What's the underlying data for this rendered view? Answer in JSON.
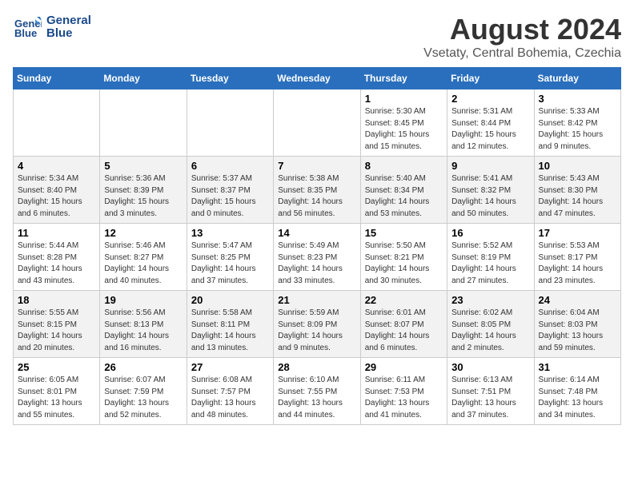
{
  "header": {
    "logo_line1": "General",
    "logo_line2": "Blue",
    "title": "August 2024",
    "subtitle": "Vsetaty, Central Bohemia, Czechia"
  },
  "weekdays": [
    "Sunday",
    "Monday",
    "Tuesday",
    "Wednesday",
    "Thursday",
    "Friday",
    "Saturday"
  ],
  "weeks": [
    [
      {
        "day": "",
        "info": ""
      },
      {
        "day": "",
        "info": ""
      },
      {
        "day": "",
        "info": ""
      },
      {
        "day": "",
        "info": ""
      },
      {
        "day": "1",
        "info": "Sunrise: 5:30 AM\nSunset: 8:45 PM\nDaylight: 15 hours\nand 15 minutes."
      },
      {
        "day": "2",
        "info": "Sunrise: 5:31 AM\nSunset: 8:44 PM\nDaylight: 15 hours\nand 12 minutes."
      },
      {
        "day": "3",
        "info": "Sunrise: 5:33 AM\nSunset: 8:42 PM\nDaylight: 15 hours\nand 9 minutes."
      }
    ],
    [
      {
        "day": "4",
        "info": "Sunrise: 5:34 AM\nSunset: 8:40 PM\nDaylight: 15 hours\nand 6 minutes."
      },
      {
        "day": "5",
        "info": "Sunrise: 5:36 AM\nSunset: 8:39 PM\nDaylight: 15 hours\nand 3 minutes."
      },
      {
        "day": "6",
        "info": "Sunrise: 5:37 AM\nSunset: 8:37 PM\nDaylight: 15 hours\nand 0 minutes."
      },
      {
        "day": "7",
        "info": "Sunrise: 5:38 AM\nSunset: 8:35 PM\nDaylight: 14 hours\nand 56 minutes."
      },
      {
        "day": "8",
        "info": "Sunrise: 5:40 AM\nSunset: 8:34 PM\nDaylight: 14 hours\nand 53 minutes."
      },
      {
        "day": "9",
        "info": "Sunrise: 5:41 AM\nSunset: 8:32 PM\nDaylight: 14 hours\nand 50 minutes."
      },
      {
        "day": "10",
        "info": "Sunrise: 5:43 AM\nSunset: 8:30 PM\nDaylight: 14 hours\nand 47 minutes."
      }
    ],
    [
      {
        "day": "11",
        "info": "Sunrise: 5:44 AM\nSunset: 8:28 PM\nDaylight: 14 hours\nand 43 minutes."
      },
      {
        "day": "12",
        "info": "Sunrise: 5:46 AM\nSunset: 8:27 PM\nDaylight: 14 hours\nand 40 minutes."
      },
      {
        "day": "13",
        "info": "Sunrise: 5:47 AM\nSunset: 8:25 PM\nDaylight: 14 hours\nand 37 minutes."
      },
      {
        "day": "14",
        "info": "Sunrise: 5:49 AM\nSunset: 8:23 PM\nDaylight: 14 hours\nand 33 minutes."
      },
      {
        "day": "15",
        "info": "Sunrise: 5:50 AM\nSunset: 8:21 PM\nDaylight: 14 hours\nand 30 minutes."
      },
      {
        "day": "16",
        "info": "Sunrise: 5:52 AM\nSunset: 8:19 PM\nDaylight: 14 hours\nand 27 minutes."
      },
      {
        "day": "17",
        "info": "Sunrise: 5:53 AM\nSunset: 8:17 PM\nDaylight: 14 hours\nand 23 minutes."
      }
    ],
    [
      {
        "day": "18",
        "info": "Sunrise: 5:55 AM\nSunset: 8:15 PM\nDaylight: 14 hours\nand 20 minutes."
      },
      {
        "day": "19",
        "info": "Sunrise: 5:56 AM\nSunset: 8:13 PM\nDaylight: 14 hours\nand 16 minutes."
      },
      {
        "day": "20",
        "info": "Sunrise: 5:58 AM\nSunset: 8:11 PM\nDaylight: 14 hours\nand 13 minutes."
      },
      {
        "day": "21",
        "info": "Sunrise: 5:59 AM\nSunset: 8:09 PM\nDaylight: 14 hours\nand 9 minutes."
      },
      {
        "day": "22",
        "info": "Sunrise: 6:01 AM\nSunset: 8:07 PM\nDaylight: 14 hours\nand 6 minutes."
      },
      {
        "day": "23",
        "info": "Sunrise: 6:02 AM\nSunset: 8:05 PM\nDaylight: 14 hours\nand 2 minutes."
      },
      {
        "day": "24",
        "info": "Sunrise: 6:04 AM\nSunset: 8:03 PM\nDaylight: 13 hours\nand 59 minutes."
      }
    ],
    [
      {
        "day": "25",
        "info": "Sunrise: 6:05 AM\nSunset: 8:01 PM\nDaylight: 13 hours\nand 55 minutes."
      },
      {
        "day": "26",
        "info": "Sunrise: 6:07 AM\nSunset: 7:59 PM\nDaylight: 13 hours\nand 52 minutes."
      },
      {
        "day": "27",
        "info": "Sunrise: 6:08 AM\nSunset: 7:57 PM\nDaylight: 13 hours\nand 48 minutes."
      },
      {
        "day": "28",
        "info": "Sunrise: 6:10 AM\nSunset: 7:55 PM\nDaylight: 13 hours\nand 44 minutes."
      },
      {
        "day": "29",
        "info": "Sunrise: 6:11 AM\nSunset: 7:53 PM\nDaylight: 13 hours\nand 41 minutes."
      },
      {
        "day": "30",
        "info": "Sunrise: 6:13 AM\nSunset: 7:51 PM\nDaylight: 13 hours\nand 37 minutes."
      },
      {
        "day": "31",
        "info": "Sunrise: 6:14 AM\nSunset: 7:48 PM\nDaylight: 13 hours\nand 34 minutes."
      }
    ]
  ]
}
